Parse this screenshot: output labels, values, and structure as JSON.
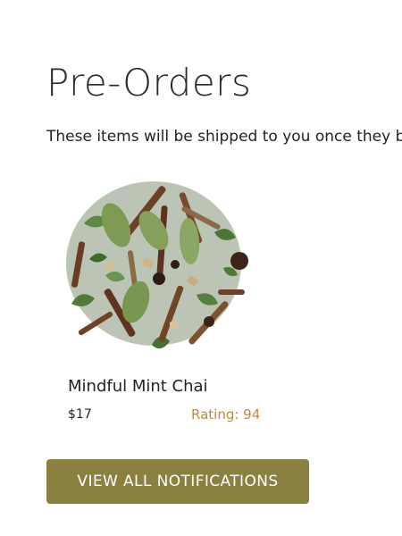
{
  "page": {
    "title": "Pre-Orders",
    "subtitle": "These items will be shipped to you once they become available."
  },
  "product": {
    "name": "Mindful Mint Chai",
    "price": "$17",
    "rating": "Rating: 94",
    "image": "loose-leaf-tea-blend-image"
  },
  "actions": {
    "view_all_label": "VIEW ALL NOTIFICATIONS"
  },
  "colors": {
    "button_bg": "#8a8140",
    "rating_text": "#c08a3e"
  }
}
